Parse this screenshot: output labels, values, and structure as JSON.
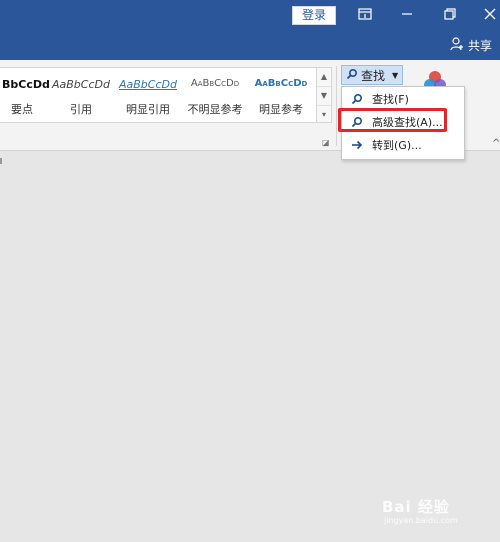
{
  "titlebar": {
    "login_label": "登录",
    "share_label": "共享",
    "bg_color": "#2b579a"
  },
  "styles_gallery": {
    "items": [
      {
        "preview": "BbCcDd",
        "name": "要点"
      },
      {
        "preview": "AaBbCcDd",
        "name": "引用"
      },
      {
        "preview": "AaBbCcDd",
        "name": "明显引用"
      },
      {
        "preview": "AaBbCcDd",
        "name": "不明显参考"
      },
      {
        "preview": "AaBbCcDd",
        "name": "明显参考"
      }
    ]
  },
  "editing": {
    "find_label": "查找",
    "menu": [
      {
        "label": "查找(F)",
        "icon": "search-icon"
      },
      {
        "label": "高级查找(A)...",
        "icon": "search-icon"
      },
      {
        "label": "转到(G)...",
        "icon": "arrow-right-icon"
      }
    ],
    "highlighted_item": "高级查找(A)..."
  },
  "watermark": {
    "main": "Bai 经验",
    "sub": "jingyan.baidu.com"
  },
  "colors": {
    "accent": "#2b579a",
    "highlight": "#e3262a",
    "canvas": "#e6e6e6"
  }
}
